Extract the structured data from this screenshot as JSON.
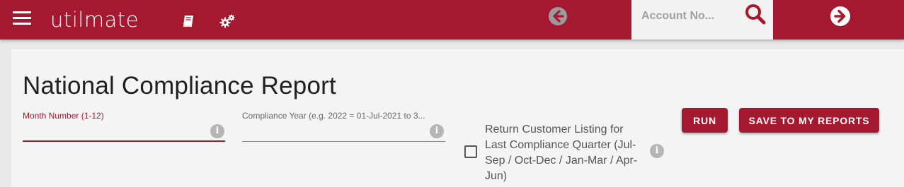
{
  "app": {
    "logo_text": "utilmate",
    "brand_color": "#a51930"
  },
  "topbar": {
    "icons": {
      "menu": "hamburger-menu-icon",
      "book": "book-icon",
      "settings": "gears-icon",
      "back": "arrow-left-circle-icon",
      "search": "search-icon",
      "forward": "arrow-right-circle-icon"
    },
    "search": {
      "placeholder": "Account No...",
      "value": ""
    }
  },
  "page": {
    "title": "National Compliance Report"
  },
  "form": {
    "month": {
      "label": "Month Number (1-12)",
      "value": "",
      "info_glyph": "i"
    },
    "year": {
      "label": "Compliance Year (e.g. 2022 = 01-Jul-2021 to 3...",
      "value": "",
      "info_glyph": "i"
    },
    "customer_listing": {
      "label": "Return Customer Listing for Last Compliance Quarter (Jul-Sep / Oct-Dec / Jan-Mar / Apr-Jun)",
      "checked": false,
      "info_glyph": "i"
    }
  },
  "actions": {
    "run_label": "RUN",
    "save_label": "SAVE TO MY REPORTS"
  }
}
